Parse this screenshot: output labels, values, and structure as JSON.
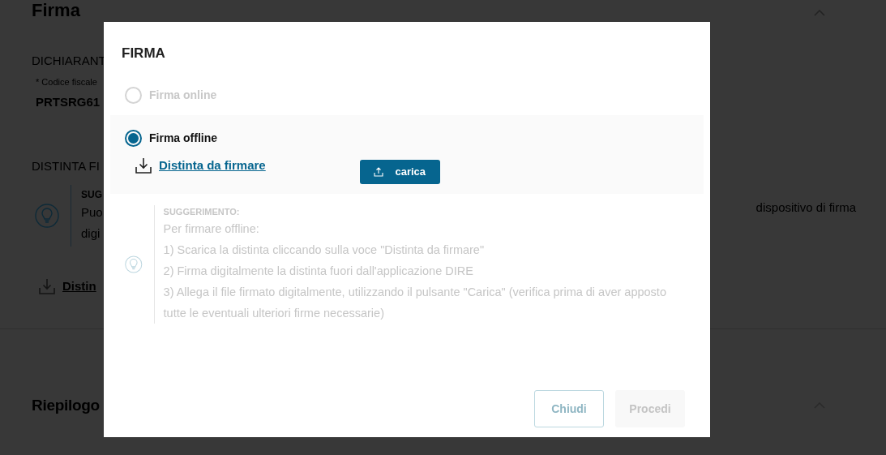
{
  "background": {
    "section_title": "Firma",
    "declarant_heading": "DICHIARANT",
    "tax_code_label": "* Codice fiscale",
    "tax_code_value": "PRTSRG61",
    "distinta_heading": "DISTINTA FI",
    "hint_title": "SUG",
    "hint_line_1": "Puo",
    "hint_line_1_end": "dispositivo di firma",
    "hint_line_2": "digi",
    "download_link": "Distin",
    "summary_title": "Riepilogo"
  },
  "dialog": {
    "title": "FIRMA",
    "options": [
      {
        "label": "Firma online",
        "selected": false,
        "disabled": true
      },
      {
        "label": "Firma offline",
        "selected": true,
        "disabled": false
      }
    ],
    "download_link": "Distinta da firmare",
    "upload_button": "carica",
    "hint": {
      "title": "SUGGERIMENTO:",
      "lines": [
        "Per firmare offline:",
        "1) Scarica la distinta cliccando sulla voce \"Distinta da firmare\"",
        "2) Firma digitalmente la distinta fuori dall'applicazione DIRE",
        "3) Allega il file firmato digitalmente, utilizzando il pulsante \"Carica\" (verifica prima di aver apposto tutte le eventuali ulteriori firme necessarie)"
      ]
    },
    "buttons": [
      {
        "label": "Chiudi",
        "kind": "outline",
        "disabled": false
      },
      {
        "label": "Procedi",
        "kind": "primary",
        "disabled": true
      }
    ]
  }
}
